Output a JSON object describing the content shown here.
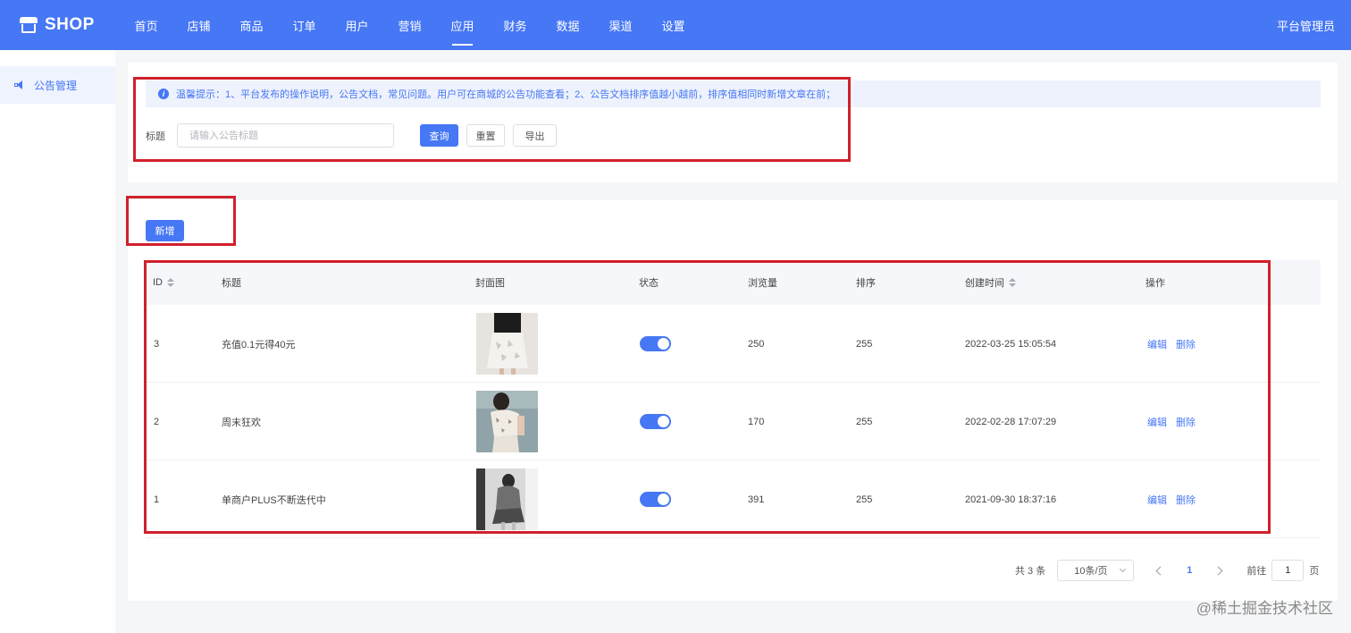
{
  "app": {
    "logo_text": "SHOP",
    "admin_label": "平台管理员"
  },
  "nav": {
    "items": [
      {
        "label": "首页"
      },
      {
        "label": "店铺"
      },
      {
        "label": "商品"
      },
      {
        "label": "订单"
      },
      {
        "label": "用户"
      },
      {
        "label": "营销"
      },
      {
        "label": "应用"
      },
      {
        "label": "财务"
      },
      {
        "label": "数据"
      },
      {
        "label": "渠道"
      },
      {
        "label": "设置"
      }
    ],
    "active": "应用"
  },
  "sidebar": {
    "items": [
      {
        "label": "公告管理",
        "icon": "speaker-icon"
      }
    ]
  },
  "tip": {
    "text": "温馨提示：1、平台发布的操作说明，公告文档，常见问题。用户可在商城的公告功能查看；2、公告文档排序值越小越前，排序值相同时新增文章在前；"
  },
  "search": {
    "label": "标题",
    "placeholder": "请输入公告标题",
    "query_label": "查询",
    "reset_label": "重置",
    "export_label": "导出"
  },
  "toolbar": {
    "add_label": "新增"
  },
  "table": {
    "headers": {
      "id": "ID",
      "title": "标题",
      "cover": "封面图",
      "status": "状态",
      "views": "浏览量",
      "sort": "排序",
      "created": "创建时间",
      "actions": "操作"
    },
    "rows": [
      {
        "id": "3",
        "title": "充值0.1元得40元",
        "views": "250",
        "sort": "255",
        "created": "2022-03-25 15:05:54",
        "status_on": true,
        "edit": "编辑",
        "delete": "删除"
      },
      {
        "id": "2",
        "title": "周末狂欢",
        "views": "170",
        "sort": "255",
        "created": "2022-02-28 17:07:29",
        "status_on": true,
        "edit": "编辑",
        "delete": "删除"
      },
      {
        "id": "1",
        "title": "单商户PLUS不断迭代中",
        "views": "391",
        "sort": "255",
        "created": "2021-09-30 18:37:16",
        "status_on": true,
        "edit": "编辑",
        "delete": "删除"
      }
    ]
  },
  "pagination": {
    "total_text": "共 3 条",
    "page_size": "10条/页",
    "current_page": "1",
    "goto_prefix": "前往",
    "goto_value": "1",
    "goto_suffix": "页"
  },
  "watermark": "@稀土掘金技术社区",
  "colors": {
    "primary": "#4677f4",
    "annotation": "#d0202c"
  }
}
